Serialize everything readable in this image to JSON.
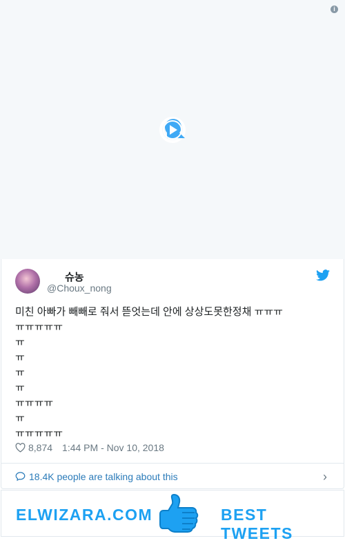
{
  "media": {
    "info_icon": "info-icon",
    "loader_icon": "play-loader-icon"
  },
  "tweet": {
    "name": "슈농",
    "handle": "@Choux_nong",
    "lines": [
      "미친 아빠가 빼빼로 줘서 뜯엇는데 안에 상상도못한정채 ㅠㅠㅠ",
      "ㅠㅠㅠㅠㅠ",
      "ㅠ",
      "ㅠ",
      "ㅠ",
      "ㅠ",
      "ㅠㅠㅠㅠ",
      "ㅠ",
      "ㅠㅠㅠㅠㅠ"
    ],
    "likes": "8,874",
    "timestamp": "1:44 PM - Nov 10, 2018",
    "talking": "18.4K people are talking about this"
  },
  "banner": {
    "left": "ELWIZARA.COM",
    "right": "BEST TWEETS"
  },
  "colors": {
    "accent": "#1da1f2",
    "link": "#2b7bb9",
    "muted": "#697882"
  }
}
